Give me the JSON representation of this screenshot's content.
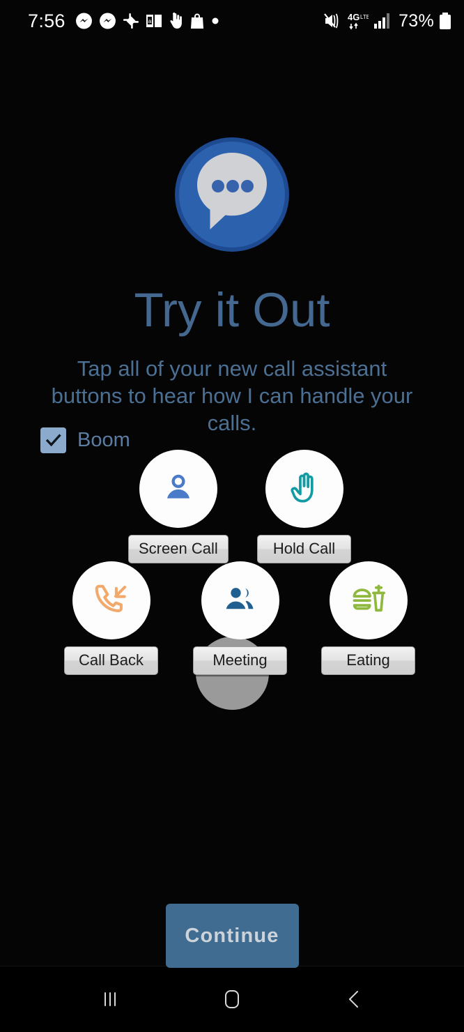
{
  "status_bar": {
    "time": "7:56",
    "left_icons": [
      "messenger-icon",
      "messenger-icon",
      "slack-icon",
      "kindle-book-icon",
      "tap-hand-icon",
      "shopping-bag-icon",
      "dot-icon"
    ],
    "right_icons": [
      "volume-mute-vibrate-icon",
      "4g-lte-data-icon",
      "signal-bars-icon"
    ],
    "battery_percent": "73%"
  },
  "app": {
    "logo": "speech-bubble-logo",
    "title": "Try it Out",
    "subtitle": "Tap all of your new call assistant buttons to hear how I can handle your calls."
  },
  "checkbox": {
    "label": "Boom",
    "checked": true
  },
  "buttons": [
    {
      "id": "screen-call",
      "label": "Screen Call",
      "icon": "person-icon",
      "color": "#4a7bc8"
    },
    {
      "id": "hold-call",
      "label": "Hold Call",
      "icon": "hand-stop-icon",
      "color": "#129ba3"
    },
    {
      "id": "call-back",
      "label": "Call Back",
      "icon": "phone-incoming-icon",
      "color": "#f2a96c"
    },
    {
      "id": "meeting",
      "label": "Meeting",
      "icon": "people-group-icon",
      "color": "#1f6091"
    },
    {
      "id": "eating",
      "label": "Eating",
      "icon": "burger-drink-icon",
      "color": "#8fb83f"
    }
  ],
  "continue": {
    "label": "Continue"
  },
  "nav_bar": {
    "recents": "recents-icon",
    "home": "home-icon",
    "back": "back-icon"
  },
  "colors": {
    "background": "#050505",
    "title": "#44688f",
    "subtitle": "#4c6f94",
    "accent": "#3f6c90",
    "checkbox": "#8cabcc",
    "logo_blue": "#2b5ca8"
  }
}
